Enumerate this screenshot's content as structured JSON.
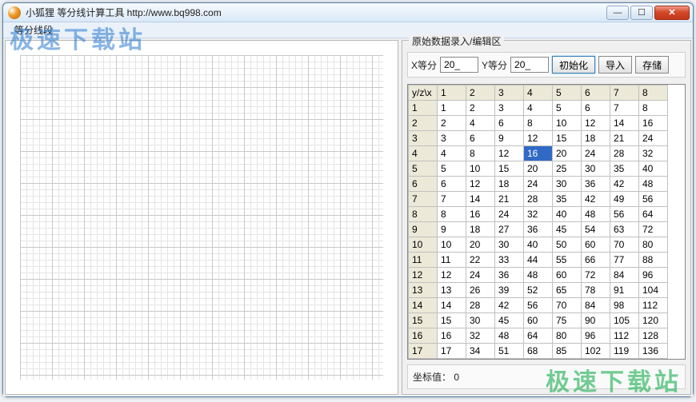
{
  "window": {
    "title": "小狐狸 等分线计算工具   http://www.bq998.com"
  },
  "menubar": {
    "item0": "等分线段"
  },
  "groupbox": {
    "title": "原始数据录入/编辑区"
  },
  "controls": {
    "x_label": "X等分",
    "x_value": "20_",
    "y_label": "Y等分",
    "y_value": "20_",
    "btn_init": "初始化",
    "btn_import": "导入",
    "btn_save": "存储"
  },
  "table": {
    "corner": "y/z\\x",
    "col_headers": [
      "1",
      "2",
      "3",
      "4",
      "5",
      "6",
      "7",
      "8"
    ],
    "row_headers": [
      "1",
      "2",
      "3",
      "4",
      "5",
      "6",
      "7",
      "8",
      "9",
      "10",
      "11",
      "12",
      "13",
      "14",
      "15",
      "16",
      "17"
    ],
    "rows": [
      [
        1,
        2,
        3,
        4,
        5,
        6,
        7,
        8
      ],
      [
        2,
        4,
        6,
        8,
        10,
        12,
        14,
        16
      ],
      [
        3,
        6,
        9,
        12,
        15,
        18,
        21,
        24
      ],
      [
        4,
        8,
        12,
        16,
        20,
        24,
        28,
        32
      ],
      [
        5,
        10,
        15,
        20,
        25,
        30,
        35,
        40
      ],
      [
        6,
        12,
        18,
        24,
        30,
        36,
        42,
        48
      ],
      [
        7,
        14,
        21,
        28,
        35,
        42,
        49,
        56
      ],
      [
        8,
        16,
        24,
        32,
        40,
        48,
        56,
        64
      ],
      [
        9,
        18,
        27,
        36,
        45,
        54,
        63,
        72
      ],
      [
        10,
        20,
        30,
        40,
        50,
        60,
        70,
        80
      ],
      [
        11,
        22,
        33,
        44,
        55,
        66,
        77,
        88
      ],
      [
        12,
        24,
        36,
        48,
        60,
        72,
        84,
        96
      ],
      [
        13,
        26,
        39,
        52,
        65,
        78,
        91,
        104
      ],
      [
        14,
        28,
        42,
        56,
        70,
        84,
        98,
        112
      ],
      [
        15,
        30,
        45,
        60,
        75,
        90,
        105,
        120
      ],
      [
        16,
        32,
        48,
        64,
        80,
        96,
        112,
        128
      ],
      [
        17,
        34,
        51,
        68,
        85,
        102,
        119,
        136
      ]
    ],
    "selected": {
      "row": 3,
      "col": 3
    }
  },
  "status": {
    "label": "坐标值：",
    "value": "0"
  },
  "watermark": {
    "text": "极速下载站"
  }
}
